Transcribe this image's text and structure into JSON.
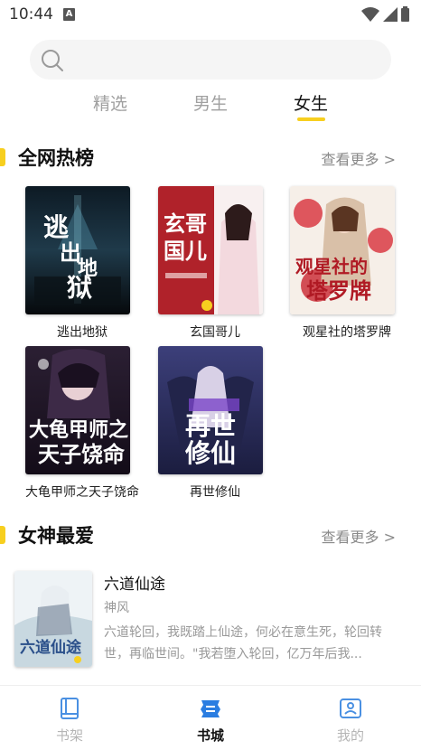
{
  "status": {
    "time": "10:44",
    "notif_glyph": "A"
  },
  "search": {
    "placeholder": ""
  },
  "tabs": [
    {
      "label": "精选",
      "active": false
    },
    {
      "label": "男生",
      "active": false
    },
    {
      "label": "女生",
      "active": true
    }
  ],
  "hot": {
    "title": "全网热榜",
    "more": "查看更多 >",
    "books": [
      {
        "title": "逃出地狱",
        "cover_text": "逃出地狱"
      },
      {
        "title": "玄国哥儿",
        "cover_text": "玄哥国儿"
      },
      {
        "title": "观星社的塔罗牌",
        "cover_text": "观星社的塔罗牌"
      },
      {
        "title": "大龟甲师之天子饶命",
        "cover_text": "大龟甲师之天子饶命"
      },
      {
        "title": "再世修仙",
        "cover_text": "再世修仙"
      }
    ]
  },
  "goddess": {
    "title": "女神最爱",
    "more": "查看更多 >",
    "featured": {
      "title": "六道仙途",
      "genre": "神风",
      "description": "六道轮回，我既踏上仙途，何必在意生死，轮回转世，再临世间。\"我若堕入轮回，亿万年后我...",
      "cover_text": "六道仙途"
    }
  },
  "nav": [
    {
      "label": "书架",
      "icon": "bookshelf-icon",
      "active": false
    },
    {
      "label": "书城",
      "icon": "bookstore-icon",
      "active": true
    },
    {
      "label": "我的",
      "icon": "profile-icon",
      "active": false
    }
  ],
  "colors": {
    "accent": "#f7cf1f",
    "muted": "#a0a0a0",
    "nav_active": "#2a7de1"
  }
}
